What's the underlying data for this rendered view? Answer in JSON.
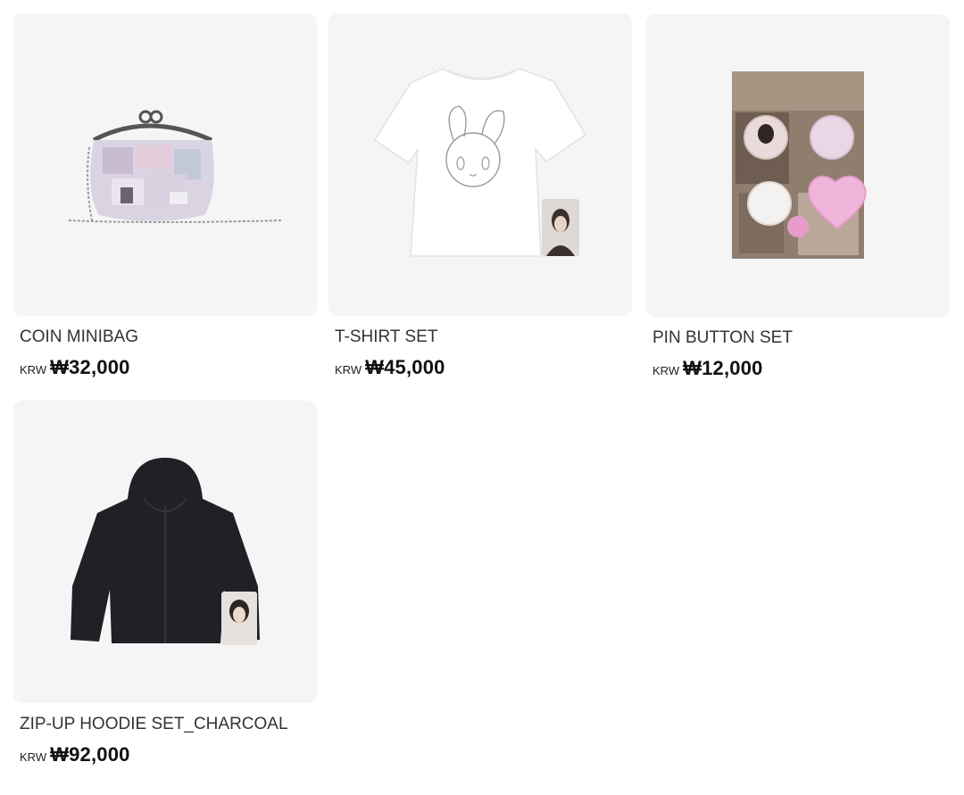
{
  "products": [
    {
      "name": "COIN MINIBAG",
      "currency": "KRW",
      "price": "₩32,000",
      "image_icon": "coin-minibag-image"
    },
    {
      "name": "T-SHIRT SET",
      "currency": "KRW",
      "price": "₩45,000",
      "image_icon": "t-shirt-image"
    },
    {
      "name": "PIN BUTTON SET",
      "currency": "KRW",
      "price": "₩12,000",
      "image_icon": "pin-button-set-image"
    },
    {
      "name": "ZIP-UP HOODIE SET_CHARCOAL",
      "currency": "KRW",
      "price": "₩92,000",
      "image_icon": "hoodie-image"
    }
  ],
  "colors": {
    "card_background": "#f5f5f5",
    "text": "#222222",
    "hoodie": "#1f2127"
  }
}
